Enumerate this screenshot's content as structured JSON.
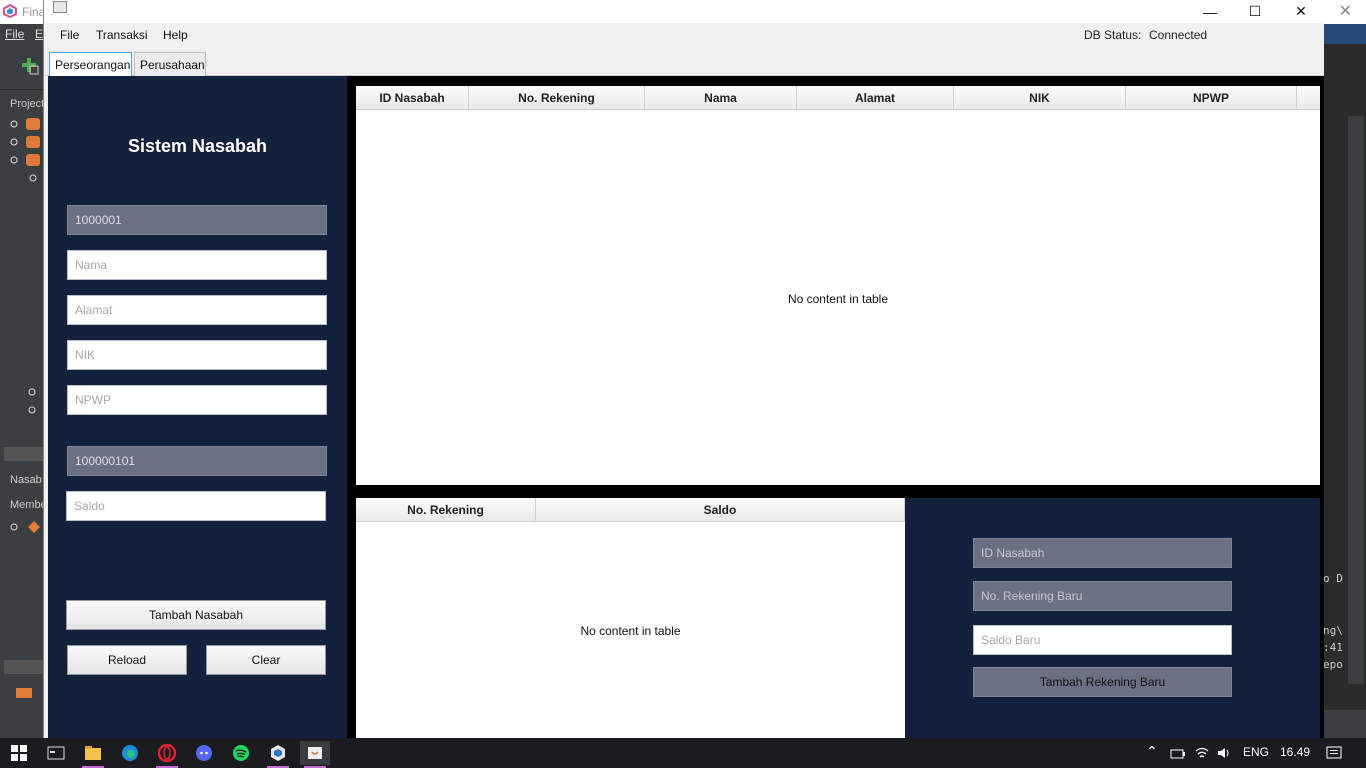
{
  "ide": {
    "title": "Fina",
    "menu": [
      "File",
      "E"
    ],
    "left_labels": [
      "Project",
      "Nasab",
      "Membe"
    ],
    "right_console": [
      "o D",
      "ng\\",
      ":41",
      "epo"
    ]
  },
  "window": {
    "controls": {
      "minimize": "—",
      "maximize": "☐",
      "close": "✕"
    }
  },
  "menubar": {
    "items": [
      "File",
      "Transaksi",
      "Help"
    ],
    "db_status_label": "DB Status:",
    "db_status_value": "Connected"
  },
  "tabs": [
    {
      "label": "Perseorangan",
      "active": true
    },
    {
      "label": "Perusahaan",
      "active": false
    }
  ],
  "left_panel": {
    "title": "Sistem Nasabah",
    "id_nasabah_value": "1000001",
    "nama_placeholder": "Nama",
    "alamat_placeholder": "Alamat",
    "nik_placeholder": "NIK",
    "npwp_placeholder": "NPWP",
    "no_rekening_value": "100000101",
    "saldo_placeholder": "Saldo",
    "tambah_button": "Tambah Nasabah",
    "reload_button": "Reload",
    "clear_button": "Clear"
  },
  "nasabah_table": {
    "columns": [
      "ID Nasabah",
      "No. Rekening",
      "Nama",
      "Alamat",
      "NIK",
      "NPWP"
    ],
    "empty_text": "No content in table"
  },
  "rekening_table": {
    "columns": [
      "No. Rekening",
      "Saldo"
    ],
    "empty_text": "No content in table"
  },
  "rekening_form": {
    "id_nasabah_placeholder": "ID Nasabah",
    "no_rekening_baru_placeholder": "No. Rekening Baru",
    "saldo_baru_placeholder": "Saldo Baru",
    "tambah_button": "Tambah Rekening Baru"
  },
  "taskbar": {
    "apps": [
      "file-explorer-icon",
      "edge-icon",
      "opera-icon",
      "discord-icon",
      "spotify-icon",
      "netbeans-icon",
      "java-icon"
    ],
    "language": "ENG",
    "time": "16.49"
  }
}
